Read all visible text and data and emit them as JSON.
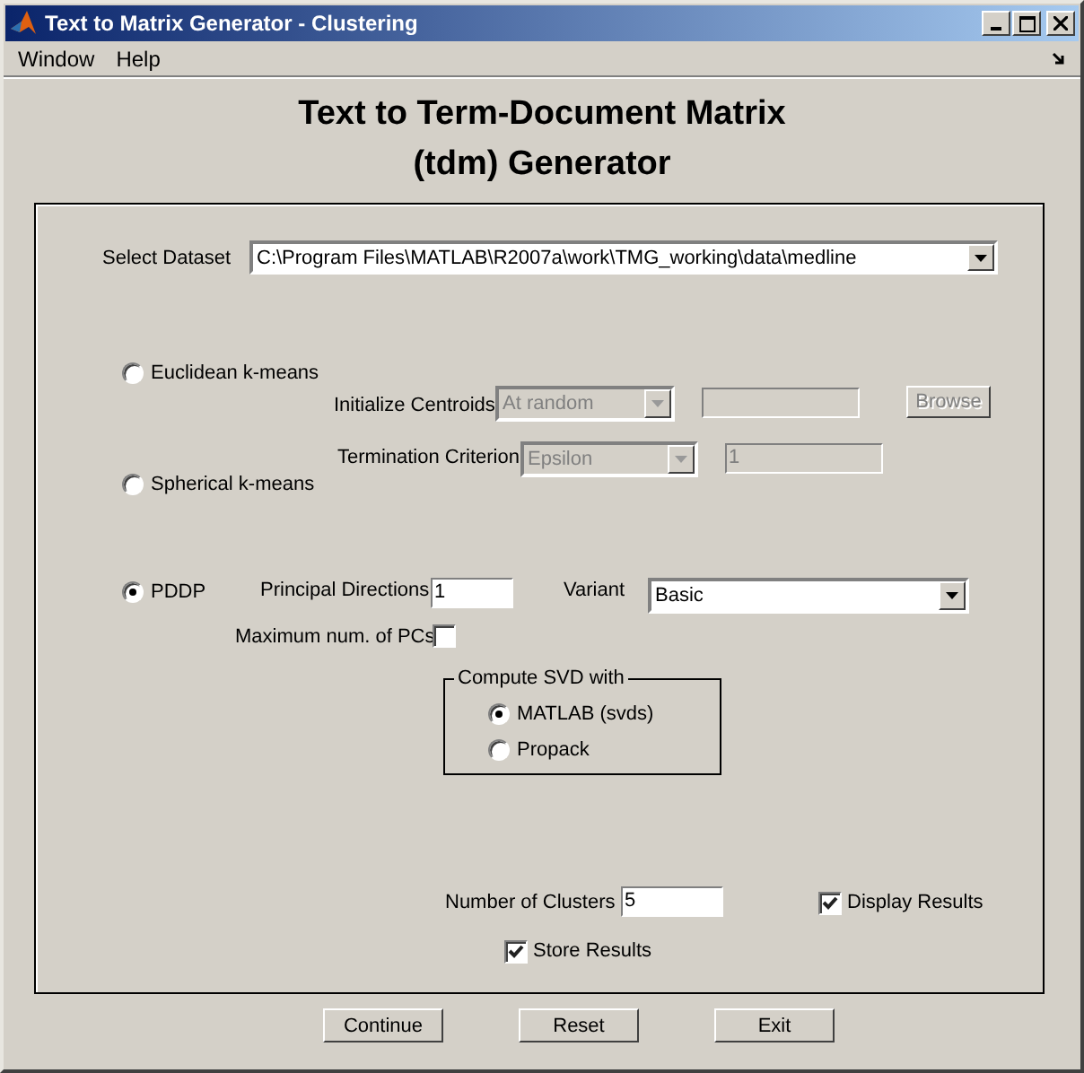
{
  "window": {
    "title": "Text to Matrix Generator - Clustering"
  },
  "menu": [
    "Window",
    "Help"
  ],
  "heading": [
    "Text to Term-Document Matrix",
    "(tdm) Generator"
  ],
  "dataset": {
    "label": "Select Dataset",
    "value": "C:\\Program Files\\MATLAB\\R2007a\\work\\TMG_working\\data\\medline"
  },
  "methods": [
    {
      "label": "Euclidean k-means",
      "selected": false
    },
    {
      "label": "Spherical k-means",
      "selected": false
    },
    {
      "label": "PDDP",
      "selected": true
    }
  ],
  "kmeans": {
    "init_label": "Initialize Centroids",
    "init_value": "At random",
    "init_disabled": true,
    "file_disabled": true,
    "browse": "Browse",
    "browse_disabled": true,
    "term_label": "Termination Criterion",
    "term_value": "Epsilon",
    "term_disabled": true,
    "epsilon": "1",
    "epsilon_disabled": true
  },
  "pddp": {
    "pd_label": "Principal Directions",
    "pd_value": "1",
    "variant_label": "Variant",
    "variant_value": "Basic",
    "maxpcs_label": "Maximum num. of PCs",
    "maxpcs_checked": false
  },
  "svd": {
    "legend": "Compute SVD with",
    "options": [
      {
        "label": "MATLAB (svds)",
        "selected": true
      },
      {
        "label": "Propack",
        "selected": false
      }
    ]
  },
  "clusters": {
    "label": "Number of Clusters",
    "value": "5"
  },
  "display_results": {
    "label": "Display Results",
    "checked": true
  },
  "store_results": {
    "label": "Store Results",
    "checked": true
  },
  "buttons": [
    "Continue",
    "Reset",
    "Exit"
  ]
}
